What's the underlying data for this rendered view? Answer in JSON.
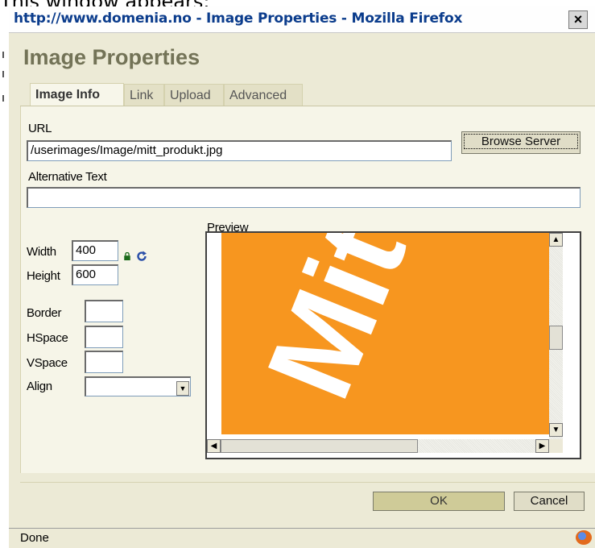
{
  "caption": "This window appears:",
  "window": {
    "title": "http://www.domenia.no - Image Properties - Mozilla Firefox",
    "close": "×"
  },
  "dialog": {
    "title": "Image Properties",
    "tabs": [
      {
        "label": "Image Info",
        "active": true
      },
      {
        "label": "Link",
        "active": false
      },
      {
        "label": "Upload",
        "active": false
      },
      {
        "label": "Advanced",
        "active": false
      }
    ]
  },
  "form": {
    "url_label": "URL",
    "url_value": "/userimages/Image/mitt_produkt.jpg",
    "browse_button": "Browse Server",
    "alt_label": "Alternative Text",
    "alt_value": "",
    "width_label": "Width",
    "width_value": "400",
    "height_label": "Height",
    "height_value": "600",
    "border_label": "Border",
    "border_value": "",
    "hspace_label": "HSpace",
    "hspace_value": "",
    "vspace_label": "VSpace",
    "vspace_value": "",
    "align_label": "Align",
    "align_value": "",
    "preview_label": "Preview",
    "preview_image_text": "Mitt",
    "preview_bg_color": "#f7961f"
  },
  "buttons": {
    "ok": "OK",
    "cancel": "Cancel"
  },
  "status": {
    "text": "Done"
  }
}
